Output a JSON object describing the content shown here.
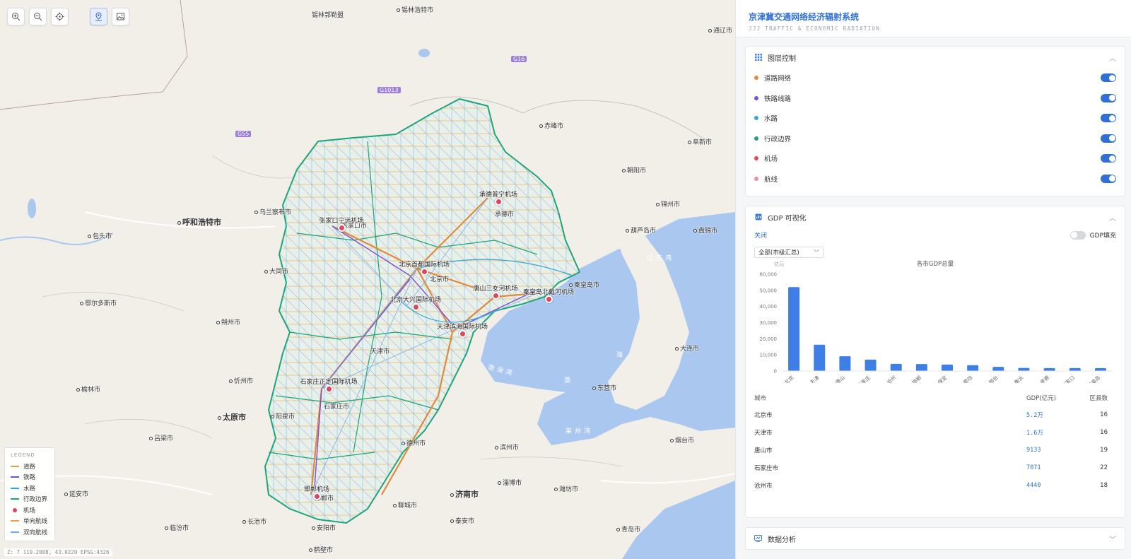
{
  "app": {
    "title": "京津冀交通网络经济辐射系统",
    "subtitle": "JJJ TRAFFIC & ECONOMIC RADIATION"
  },
  "map": {
    "status_bar": "Z: 7  110.2008, 43.0220  EPSG:4326",
    "tools": [
      {
        "name": "zoom-in-icon"
      },
      {
        "name": "zoom-out-icon"
      },
      {
        "name": "locate-icon"
      },
      {
        "name": "pin-map-icon",
        "active": true
      },
      {
        "name": "image-export-icon"
      }
    ],
    "highway_shields": [
      {
        "label": "G16"
      },
      {
        "label": "G1013"
      },
      {
        "label": "G55"
      }
    ],
    "cities": [
      {
        "label": "锡林郭勒盟",
        "dot": false
      },
      {
        "label": "锡林浩特市",
        "dot": true
      },
      {
        "label": "通辽市",
        "dot": true
      },
      {
        "label": "赤峰市",
        "dot": true
      },
      {
        "label": "阜新市",
        "dot": true
      },
      {
        "label": "朝阳市",
        "dot": true
      },
      {
        "label": "锦州市",
        "dot": true
      },
      {
        "label": "葫芦岛市",
        "dot": true
      },
      {
        "label": "盘锦市",
        "dot": true
      },
      {
        "label": "呼和浩特市",
        "dot": true,
        "big": true
      },
      {
        "label": "乌兰察布市",
        "dot": true
      },
      {
        "label": "包头市",
        "dot": true
      },
      {
        "label": "大同市",
        "dot": true
      },
      {
        "label": "鄂尔多斯市",
        "dot": true
      },
      {
        "label": "朔州市",
        "dot": true
      },
      {
        "label": "忻州市",
        "dot": true
      },
      {
        "label": "榆林市",
        "dot": true
      },
      {
        "label": "太原市",
        "dot": true,
        "big": true
      },
      {
        "label": "阳泉市",
        "dot": true
      },
      {
        "label": "吕梁市",
        "dot": true
      },
      {
        "label": "延安市",
        "dot": true
      },
      {
        "label": "长治市",
        "dot": true
      },
      {
        "label": "临汾市",
        "dot": true
      },
      {
        "label": "安阳市",
        "dot": true
      },
      {
        "label": "鹤壁市",
        "dot": true
      },
      {
        "label": "聊城市",
        "dot": true
      },
      {
        "label": "济南市",
        "dot": true,
        "big": true
      },
      {
        "label": "泰安市",
        "dot": true
      },
      {
        "label": "淄博市",
        "dot": true
      },
      {
        "label": "潍坊市",
        "dot": true
      },
      {
        "label": "滨州市",
        "dot": true
      },
      {
        "label": "德州市",
        "dot": true
      },
      {
        "label": "东营市",
        "dot": true
      },
      {
        "label": "烟台市",
        "dot": true
      },
      {
        "label": "大连市",
        "dot": true
      },
      {
        "label": "青岛市",
        "dot": true
      },
      {
        "label": "秦皇岛市",
        "dot": true
      },
      {
        "label": "承德市",
        "dot": false
      },
      {
        "label": "张家口市",
        "dot": false
      },
      {
        "label": "北京市",
        "dot": false
      },
      {
        "label": "天津市",
        "dot": false
      },
      {
        "label": "石家庄市",
        "dot": false
      },
      {
        "label": "邯郸市",
        "dot": false
      }
    ],
    "airports": [
      {
        "label": "承德普宁机场"
      },
      {
        "label": "张家口宁远机场"
      },
      {
        "label": "北京首都国际机场"
      },
      {
        "label": "唐山三女河机场"
      },
      {
        "label": "秦皇岛北戴河机场"
      },
      {
        "label": "北京大兴国际机场"
      },
      {
        "label": "天津滨海国际机场"
      },
      {
        "label": "石家庄正定国际机场"
      },
      {
        "label": "邯郸机场"
      }
    ],
    "seas": [
      {
        "label": "辽东湾"
      },
      {
        "label": "渤海湾"
      },
      {
        "label": "莱州湾"
      },
      {
        "label": "海"
      },
      {
        "label": "渤"
      }
    ],
    "legend": {
      "title": "LEGEND",
      "items": [
        {
          "label": "道路",
          "type": "line",
          "color": "#e0a040"
        },
        {
          "label": "铁路",
          "type": "line",
          "color": "#7b4fd6"
        },
        {
          "label": "水路",
          "type": "line",
          "color": "#2fa8d8"
        },
        {
          "label": "行政边界",
          "type": "line",
          "color": "#1aa57a"
        },
        {
          "label": "机场",
          "type": "dot",
          "color": "#e0445f"
        },
        {
          "label": "单向航线",
          "type": "line",
          "color": "#f0a040"
        },
        {
          "label": "双向航线",
          "type": "line",
          "color": "#6fa8e8"
        }
      ]
    }
  },
  "layers": {
    "title": "图层控制",
    "items": [
      {
        "label": "道路网络",
        "color": "#e08a3a",
        "on": true
      },
      {
        "label": "铁路线路",
        "color": "#7b4fd6",
        "on": true
      },
      {
        "label": "水路",
        "color": "#2fa8d8",
        "on": true
      },
      {
        "label": "行政边界",
        "color": "#1aa57a",
        "on": true
      },
      {
        "label": "机场",
        "color": "#e0445f",
        "on": true
      },
      {
        "label": "航线",
        "color": "#f08aa8",
        "on": true
      }
    ]
  },
  "gdp": {
    "title": "GDP 可视化",
    "switch_state": "关闭",
    "switch_label": "GDP填充",
    "select_value": "全部(市级汇总)",
    "table_headers": [
      "城市",
      "GDP(亿元)",
      "区县数"
    ],
    "table_rows": [
      {
        "city": "北京市",
        "gdp": "5.2万",
        "counties": "16"
      },
      {
        "city": "天津市",
        "gdp": "1.6万",
        "counties": "16"
      },
      {
        "city": "唐山市",
        "gdp": "9133",
        "counties": "19"
      },
      {
        "city": "石家庄市",
        "gdp": "7071",
        "counties": "22"
      },
      {
        "city": "沧州市",
        "gdp": "4440",
        "counties": "18"
      }
    ]
  },
  "analysis": {
    "title": "数据分析"
  },
  "chart_data": {
    "type": "bar",
    "title": "各市GDP总量",
    "ylabel": "亿元",
    "ylim": [
      0,
      60000
    ],
    "yticks": [
      0,
      10000,
      20000,
      30000,
      40000,
      50000,
      60000
    ],
    "ytick_labels": [
      "0",
      "10,000",
      "20,000",
      "30,000",
      "40,000",
      "50,000",
      "60,000"
    ],
    "categories": [
      "北京",
      "天津",
      "唐山",
      "石家庄",
      "沧州",
      "邯郸",
      "保定",
      "廊坊",
      "邢台",
      "衡水",
      "承德",
      "张家口",
      "秦皇岛"
    ],
    "values": [
      52000,
      16300,
      9133,
      7071,
      4440,
      4300,
      4000,
      3600,
      2600,
      1900,
      1800,
      1800,
      1800
    ],
    "color": "#3d7fe6"
  }
}
